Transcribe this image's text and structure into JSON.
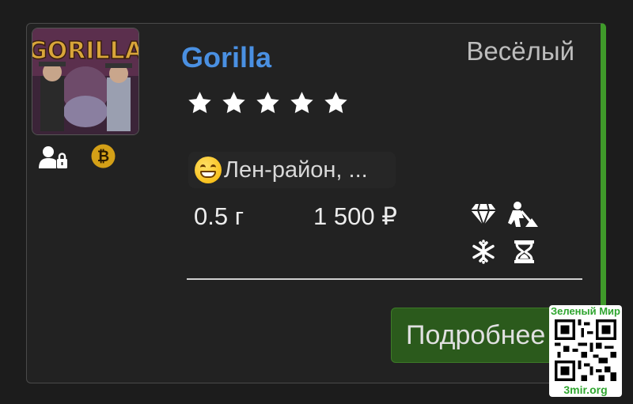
{
  "product": {
    "title": "Gorilla",
    "mood": "Весёлый",
    "rating": 5,
    "location": "Лен-район, ...",
    "weight": "0.5 г",
    "price": "1 500 ₽",
    "more_label": "Подробнее",
    "image_alt": "GORILLA"
  },
  "icons": {
    "badges": [
      "user-lock-icon",
      "bitcoin-icon"
    ],
    "features": [
      "gem-icon",
      "digging-person-icon",
      "snowflake-icon",
      "hourglass-icon"
    ]
  },
  "watermark": {
    "top": "Зеленый Мир",
    "bottom": "3mir.org"
  },
  "colors": {
    "accent_green": "#3f9a2a",
    "title_blue": "#4a90e2",
    "button_bg": "#2b5a1c",
    "bitcoin": "#d4a017"
  }
}
